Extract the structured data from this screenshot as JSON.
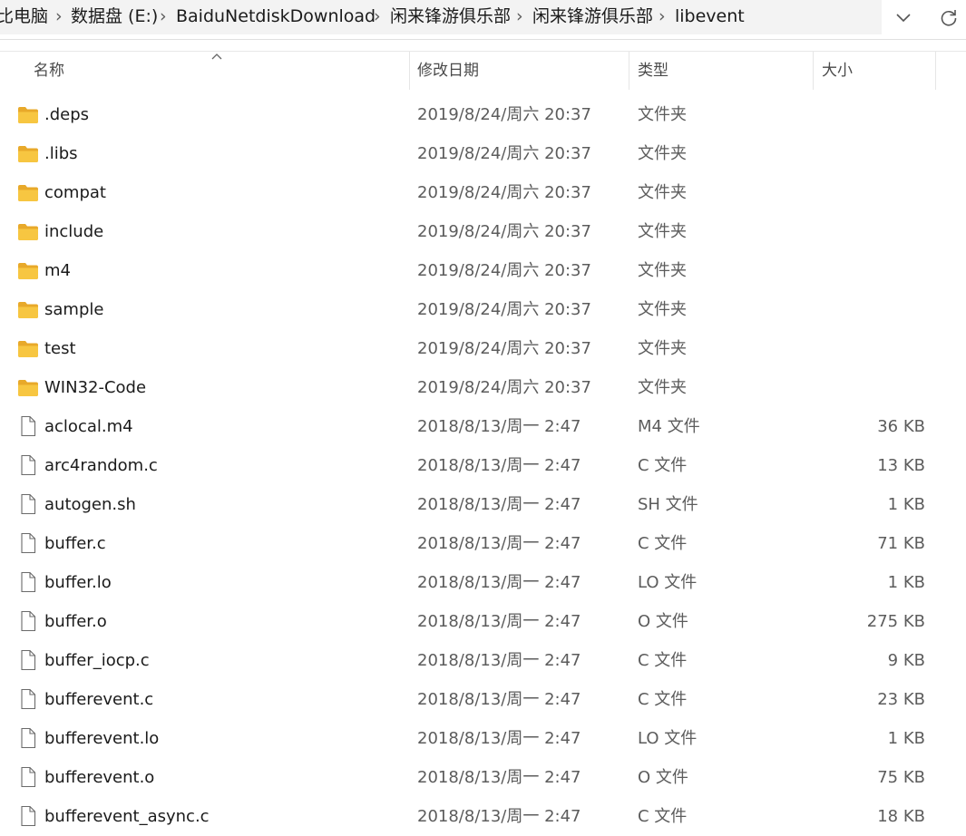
{
  "breadcrumb": {
    "items": [
      "比电脑",
      "数据盘 (E:)",
      "BaiduNetdiskDownload",
      "闲来锋游俱乐部",
      "闲来锋游俱乐部",
      "libevent"
    ],
    "separator": "›"
  },
  "columns": {
    "name": "名称",
    "modified": "修改日期",
    "type": "类型",
    "size": "大小"
  },
  "files": [
    {
      "name": ".deps",
      "modified": "2019/8/24/周六 20:37",
      "type": "文件夹",
      "size": "",
      "icon": "folder-icon"
    },
    {
      "name": ".libs",
      "modified": "2019/8/24/周六 20:37",
      "type": "文件夹",
      "size": "",
      "icon": "folder-icon"
    },
    {
      "name": "compat",
      "modified": "2019/8/24/周六 20:37",
      "type": "文件夹",
      "size": "",
      "icon": "folder-icon"
    },
    {
      "name": "include",
      "modified": "2019/8/24/周六 20:37",
      "type": "文件夹",
      "size": "",
      "icon": "folder-icon"
    },
    {
      "name": "m4",
      "modified": "2019/8/24/周六 20:37",
      "type": "文件夹",
      "size": "",
      "icon": "folder-icon"
    },
    {
      "name": "sample",
      "modified": "2019/8/24/周六 20:37",
      "type": "文件夹",
      "size": "",
      "icon": "folder-icon"
    },
    {
      "name": "test",
      "modified": "2019/8/24/周六 20:37",
      "type": "文件夹",
      "size": "",
      "icon": "folder-icon"
    },
    {
      "name": "WIN32-Code",
      "modified": "2019/8/24/周六 20:37",
      "type": "文件夹",
      "size": "",
      "icon": "folder-icon"
    },
    {
      "name": "aclocal.m4",
      "modified": "2018/8/13/周一 2:47",
      "type": "M4 文件",
      "size": "36 KB",
      "icon": "file-icon"
    },
    {
      "name": "arc4random.c",
      "modified": "2018/8/13/周一 2:47",
      "type": "C 文件",
      "size": "13 KB",
      "icon": "file-icon"
    },
    {
      "name": "autogen.sh",
      "modified": "2018/8/13/周一 2:47",
      "type": "SH 文件",
      "size": "1 KB",
      "icon": "file-icon"
    },
    {
      "name": "buffer.c",
      "modified": "2018/8/13/周一 2:47",
      "type": "C 文件",
      "size": "71 KB",
      "icon": "file-icon"
    },
    {
      "name": "buffer.lo",
      "modified": "2018/8/13/周一 2:47",
      "type": "LO 文件",
      "size": "1 KB",
      "icon": "file-icon"
    },
    {
      "name": "buffer.o",
      "modified": "2018/8/13/周一 2:47",
      "type": "O 文件",
      "size": "275 KB",
      "icon": "file-icon"
    },
    {
      "name": "buffer_iocp.c",
      "modified": "2018/8/13/周一 2:47",
      "type": "C 文件",
      "size": "9 KB",
      "icon": "file-icon"
    },
    {
      "name": "bufferevent.c",
      "modified": "2018/8/13/周一 2:47",
      "type": "C 文件",
      "size": "23 KB",
      "icon": "file-icon"
    },
    {
      "name": "bufferevent.lo",
      "modified": "2018/8/13/周一 2:47",
      "type": "LO 文件",
      "size": "1 KB",
      "icon": "file-icon"
    },
    {
      "name": "bufferevent.o",
      "modified": "2018/8/13/周一 2:47",
      "type": "O 文件",
      "size": "75 KB",
      "icon": "file-icon"
    },
    {
      "name": "bufferevent_async.c",
      "modified": "2018/8/13/周一 2:47",
      "type": "C 文件",
      "size": "18 KB",
      "icon": "file-icon"
    }
  ],
  "colors": {
    "folder": "#f7c641",
    "folder_dark": "#e8a92a",
    "breadcrumb_bg": "#f3f3f3"
  }
}
